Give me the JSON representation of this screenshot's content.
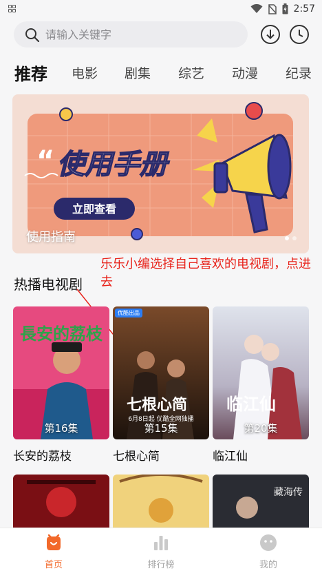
{
  "status_bar": {
    "time": "2:57"
  },
  "search": {
    "placeholder": "请输入关键字"
  },
  "tabs": [
    {
      "label": "推荐",
      "active": true
    },
    {
      "label": "电影"
    },
    {
      "label": "剧集"
    },
    {
      "label": "综艺"
    },
    {
      "label": "动漫"
    },
    {
      "label": "纪录"
    }
  ],
  "banner": {
    "headline": "使用手册",
    "button_label": "立即查看",
    "caption": "使用指南",
    "slide_count": 2,
    "active_slide": 1
  },
  "section": {
    "title": "热播电视剧"
  },
  "annotation": "乐乐小编选择自己喜欢的电视剧，点进去",
  "shows": [
    {
      "title": "长安的荔枝",
      "episodes": "第16集",
      "poster_text": "長安的荔枝"
    },
    {
      "title": "七根心简",
      "episodes": "第15集",
      "poster_text": "七根心简",
      "badge": "优酷出品",
      "poster_note": "6月8日起 优酷全网独播"
    },
    {
      "title": "临江仙",
      "episodes": "第20集",
      "poster_text": "临江仙"
    }
  ],
  "more_shows": [
    {
      "poster_text": ""
    },
    {
      "poster_text": ""
    },
    {
      "poster_text": "藏海传"
    }
  ],
  "nav": [
    {
      "label": "首页",
      "icon": "home-icon",
      "active": true
    },
    {
      "label": "排行榜",
      "icon": "chart-bars-icon"
    },
    {
      "label": "我的",
      "icon": "profile-face-icon"
    }
  ],
  "colors": {
    "accent": "#f2692a",
    "annotation": "#e8231b"
  }
}
